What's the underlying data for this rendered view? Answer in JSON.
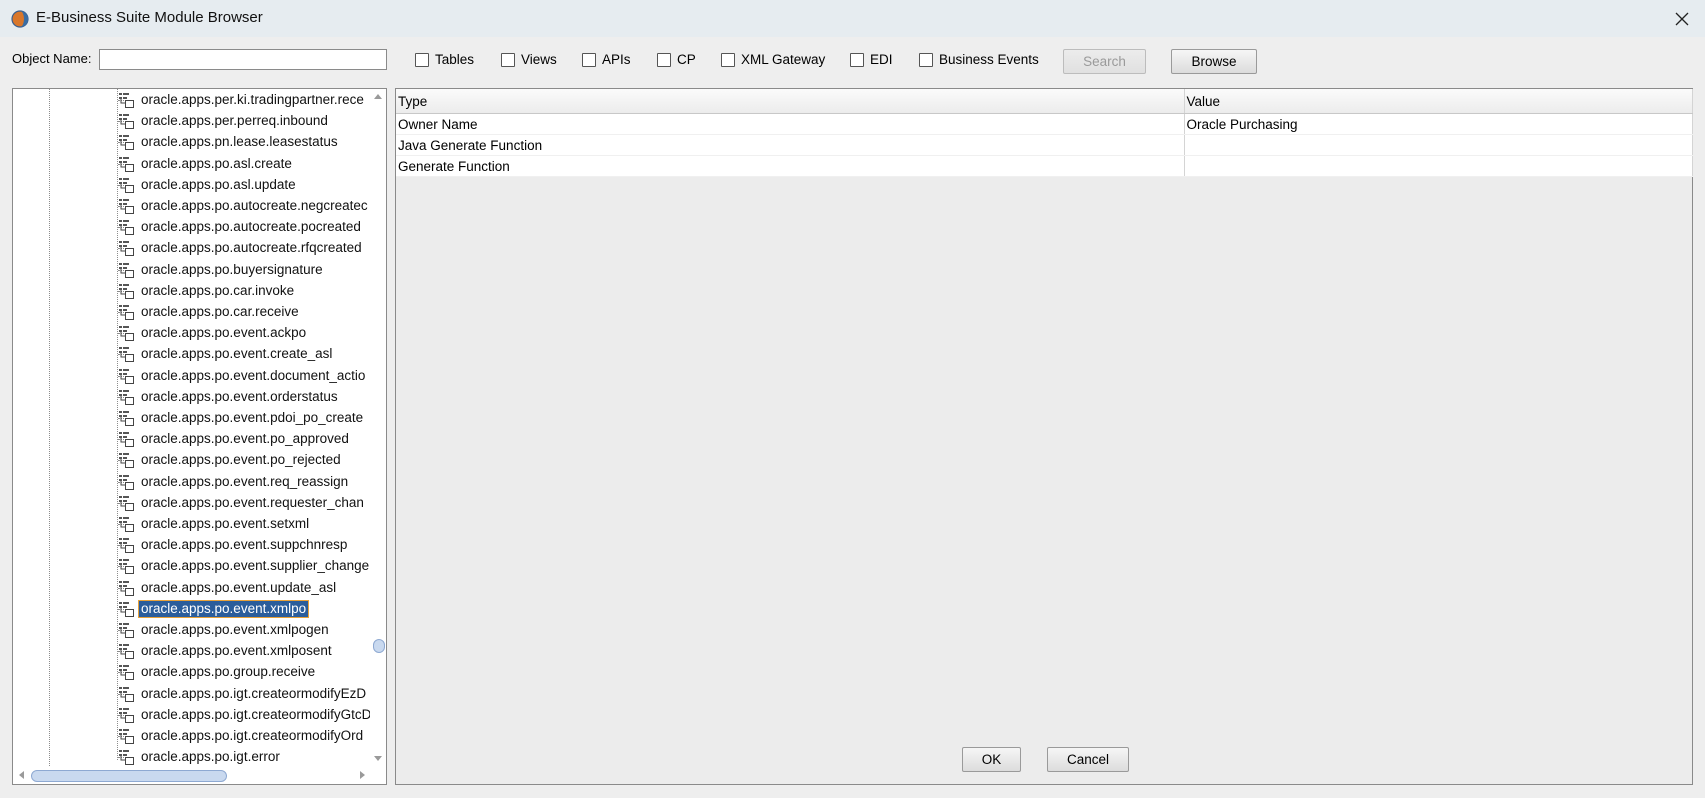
{
  "window": {
    "title": "E-Business Suite Module Browser"
  },
  "toolbar": {
    "object_name_label": "Object Name:",
    "object_name_value": "",
    "checkboxes": [
      {
        "label": "Tables",
        "checked": false
      },
      {
        "label": "Views",
        "checked": false
      },
      {
        "label": "APIs",
        "checked": false
      },
      {
        "label": "CP",
        "checked": false
      },
      {
        "label": "XML Gateway",
        "checked": false
      },
      {
        "label": "EDI",
        "checked": false
      },
      {
        "label": "Business Events",
        "checked": false
      }
    ],
    "search_label": "Search",
    "browse_label": "Browse"
  },
  "tree": {
    "items": [
      {
        "label": "oracle.apps.per.ki.tradingpartner.rece",
        "selected": false
      },
      {
        "label": "oracle.apps.per.perreq.inbound",
        "selected": false
      },
      {
        "label": "oracle.apps.pn.lease.leasestatus",
        "selected": false
      },
      {
        "label": "oracle.apps.po.asl.create",
        "selected": false
      },
      {
        "label": "oracle.apps.po.asl.update",
        "selected": false
      },
      {
        "label": "oracle.apps.po.autocreate.negcreatec",
        "selected": false
      },
      {
        "label": "oracle.apps.po.autocreate.pocreated",
        "selected": false
      },
      {
        "label": "oracle.apps.po.autocreate.rfqcreated",
        "selected": false
      },
      {
        "label": "oracle.apps.po.buyersignature",
        "selected": false
      },
      {
        "label": "oracle.apps.po.car.invoke",
        "selected": false
      },
      {
        "label": "oracle.apps.po.car.receive",
        "selected": false
      },
      {
        "label": "oracle.apps.po.event.ackpo",
        "selected": false
      },
      {
        "label": "oracle.apps.po.event.create_asl",
        "selected": false
      },
      {
        "label": "oracle.apps.po.event.document_actio",
        "selected": false
      },
      {
        "label": "oracle.apps.po.event.orderstatus",
        "selected": false
      },
      {
        "label": "oracle.apps.po.event.pdoi_po_create",
        "selected": false
      },
      {
        "label": "oracle.apps.po.event.po_approved",
        "selected": false
      },
      {
        "label": "oracle.apps.po.event.po_rejected",
        "selected": false
      },
      {
        "label": "oracle.apps.po.event.req_reassign",
        "selected": false
      },
      {
        "label": "oracle.apps.po.event.requester_chan",
        "selected": false
      },
      {
        "label": "oracle.apps.po.event.setxml",
        "selected": false
      },
      {
        "label": "oracle.apps.po.event.suppchnresp",
        "selected": false
      },
      {
        "label": "oracle.apps.po.event.supplier_change",
        "selected": false
      },
      {
        "label": "oracle.apps.po.event.update_asl",
        "selected": false
      },
      {
        "label": "oracle.apps.po.event.xmlpo",
        "selected": true
      },
      {
        "label": "oracle.apps.po.event.xmlpogen",
        "selected": false
      },
      {
        "label": "oracle.apps.po.event.xmlposent",
        "selected": false
      },
      {
        "label": "oracle.apps.po.group.receive",
        "selected": false
      },
      {
        "label": "oracle.apps.po.igt.createormodifyEzD",
        "selected": false
      },
      {
        "label": "oracle.apps.po.igt.createormodifyGtcD",
        "selected": false
      },
      {
        "label": "oracle.apps.po.igt.createormodifyOrd",
        "selected": false
      },
      {
        "label": "oracle.apps.po.igt.error",
        "selected": false
      }
    ]
  },
  "properties": {
    "headers": {
      "type": "Type",
      "value": "Value"
    },
    "rows": [
      {
        "type": "Owner Name",
        "value": "Oracle Purchasing"
      },
      {
        "type": "Java Generate Function",
        "value": ""
      },
      {
        "type": "Generate Function",
        "value": ""
      }
    ]
  },
  "footer": {
    "ok_label": "OK",
    "cancel_label": "Cancel"
  },
  "colors": {
    "selection_bg": "#2b5d9b",
    "selection_border": "#e8a23a",
    "titlebar_bg": "#e6ecf0",
    "dialog_bg": "#eeeeee"
  }
}
